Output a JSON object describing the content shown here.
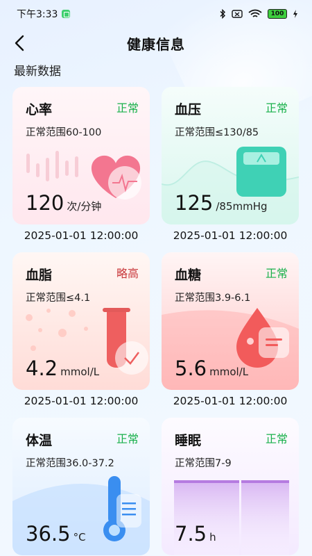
{
  "status_bar": {
    "time": "下午3:33",
    "battery": "100"
  },
  "header": {
    "title": "健康信息"
  },
  "section": {
    "title": "最新数据"
  },
  "cards": [
    {
      "name": "心率",
      "status": "正常",
      "range": "正常范围60-100",
      "value": "120",
      "unit": "次/分钟",
      "time": "2025-01-01 12:00:00",
      "icon": "heart-icon"
    },
    {
      "name": "血压",
      "status": "正常",
      "range": "正常范围≤130/85",
      "value": "125",
      "unit": "/85mmHg",
      "time": "2025-01-01 12:00:00",
      "icon": "scale-icon"
    },
    {
      "name": "血脂",
      "status": "略高",
      "range": "正常范围≤4.1",
      "value": "4.2",
      "unit": "mmol/L",
      "time": "2025-01-01 12:00:00",
      "icon": "test-tube-icon"
    },
    {
      "name": "血糖",
      "status": "正常",
      "range": "正常范围3.9-6.1",
      "value": "5.6",
      "unit": "mmol/L",
      "time": "2025-01-01 12:00:00",
      "icon": "blood-drop-icon"
    },
    {
      "name": "体温",
      "status": "正常",
      "range": "正常范围36.0-37.2",
      "value": "36.5",
      "unit": "°C",
      "time": "",
      "icon": "thermometer-icon"
    },
    {
      "name": "睡眠",
      "status": "正常",
      "range": "正常范围7-9",
      "value": "7.5",
      "unit": "h",
      "time": "",
      "icon": "sleep-bars-icon"
    }
  ],
  "colors": {
    "normal": "#18b04a",
    "warning": "#c8373a",
    "accent_heart": "#f0607a",
    "accent_pressure": "#3fd1b5",
    "accent_sugar": "#f25b5b",
    "accent_temp": "#3a8ef0",
    "accent_sleep": "#b57be0"
  }
}
